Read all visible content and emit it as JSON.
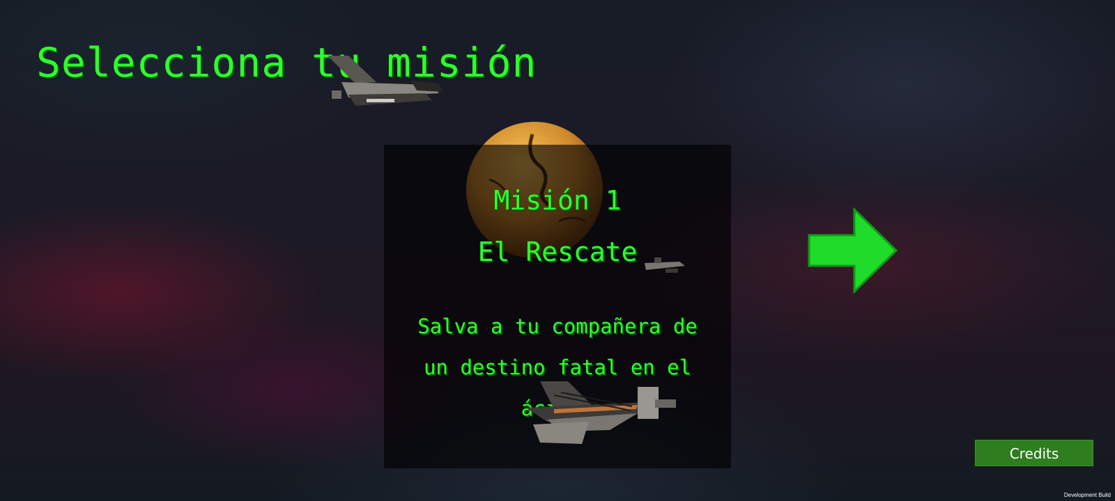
{
  "screen": {
    "title": "Selecciona tu misión"
  },
  "mission": {
    "number_label": "Misión 1",
    "name": "El Rescate",
    "description": "Salva a tu compañera de un destino fatal en el ácido."
  },
  "navigation": {
    "next_icon": "right-arrow-icon"
  },
  "footer": {
    "credits_label": "Credits",
    "build_label": "Development Build"
  },
  "colors": {
    "accent_text": "#2dff2d",
    "arrow": "#1fdc2a",
    "credits_bg": "#2e7d1e",
    "panel_bg": "rgba(0,0,0,0.62)"
  }
}
